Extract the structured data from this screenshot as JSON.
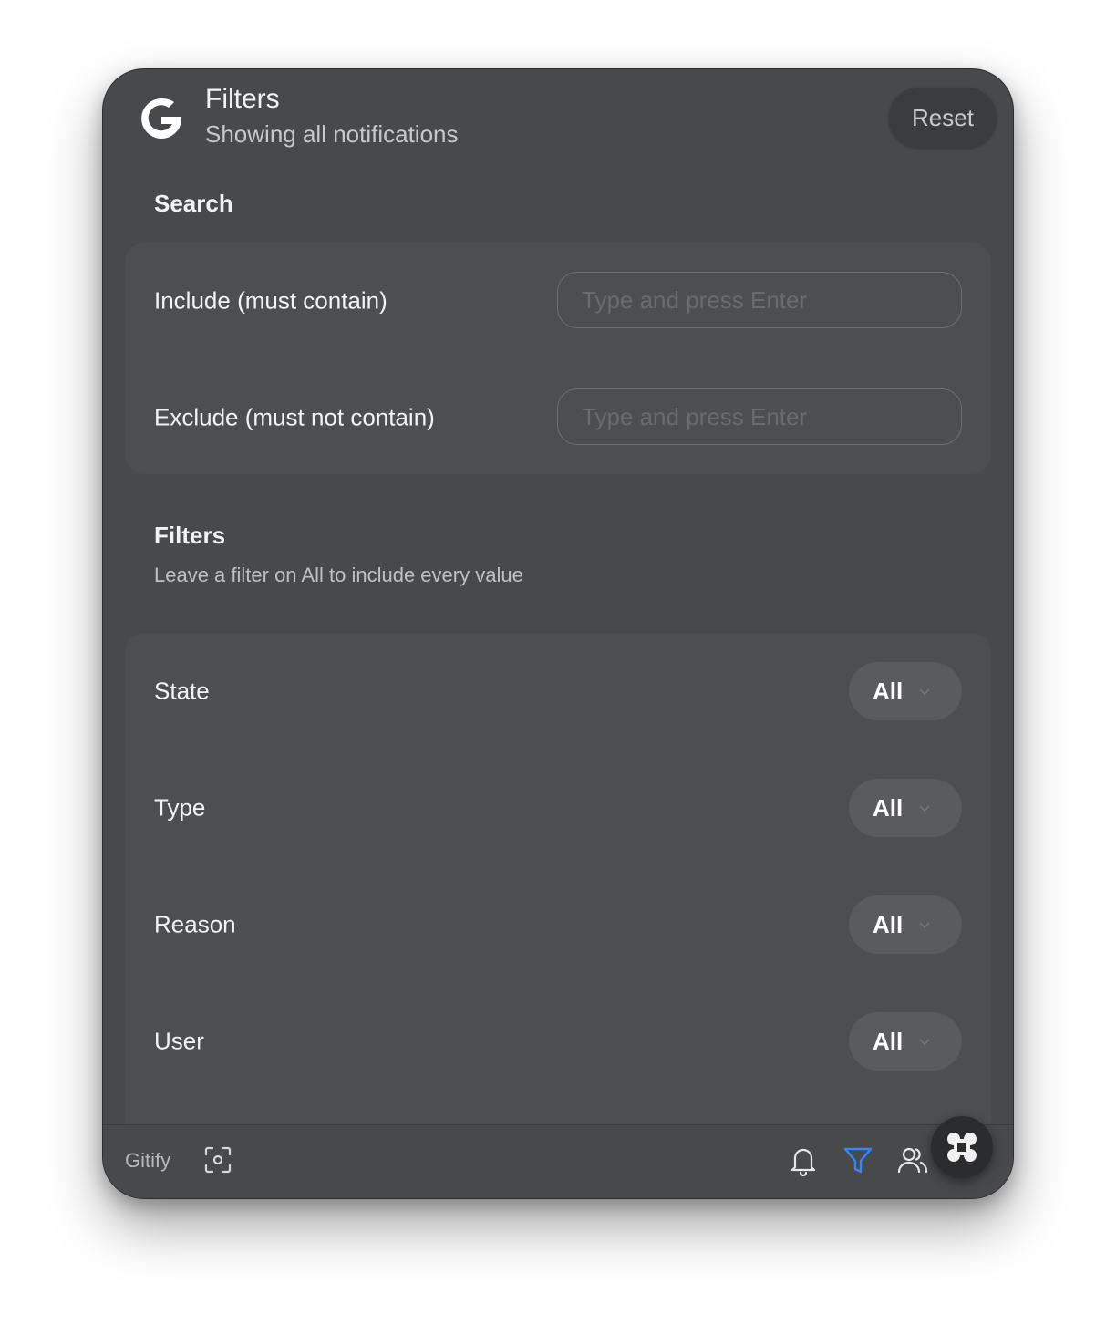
{
  "header": {
    "title": "Filters",
    "subtitle": "Showing all notifications",
    "reset_label": "Reset",
    "logo_icon": "gitify-logo-icon"
  },
  "search": {
    "heading": "Search",
    "include_label": "Include (must contain)",
    "include_placeholder": "Type and press Enter",
    "include_value": "",
    "exclude_label": "Exclude (must not contain)",
    "exclude_placeholder": "Type and press Enter",
    "exclude_value": ""
  },
  "filters": {
    "heading": "Filters",
    "subheading": "Leave a filter on All to include every value",
    "rows": [
      {
        "label": "State",
        "value": "All"
      },
      {
        "label": "Type",
        "value": "All"
      },
      {
        "label": "Reason",
        "value": "All"
      },
      {
        "label": "User",
        "value": "All"
      }
    ]
  },
  "footer": {
    "brand": "Gitify",
    "icons": [
      "screenshot-icon",
      "bell-icon",
      "filter-icon",
      "users-icon"
    ],
    "active_icon": "filter-icon",
    "active_color": "#2f88ff",
    "fab_icon": "command-icon"
  }
}
